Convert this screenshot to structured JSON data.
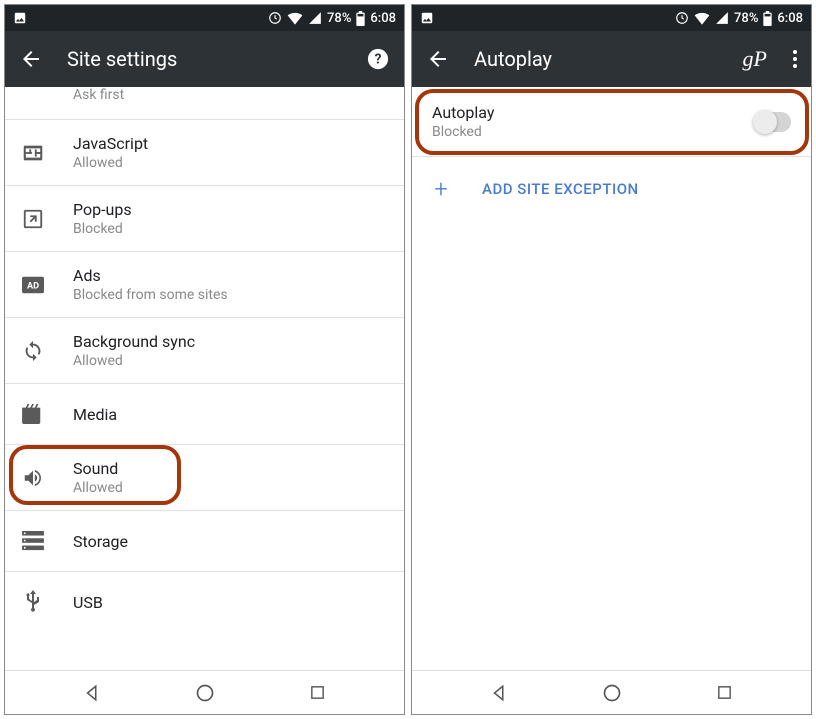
{
  "status": {
    "battery": "78%",
    "time": "6:08"
  },
  "left": {
    "title": "Site settings",
    "items": {
      "ask_first": {
        "label": "Ask first"
      },
      "javascript": {
        "label": "JavaScript",
        "sub": "Allowed"
      },
      "popups": {
        "label": "Pop-ups",
        "sub": "Blocked"
      },
      "ads": {
        "label": "Ads",
        "sub": "Blocked from some sites"
      },
      "bgsync": {
        "label": "Background sync",
        "sub": "Allowed"
      },
      "media": {
        "label": "Media"
      },
      "sound": {
        "label": "Sound",
        "sub": "Allowed"
      },
      "storage": {
        "label": "Storage"
      },
      "usb": {
        "label": "USB"
      }
    }
  },
  "right": {
    "title": "Autoplay",
    "toggle": {
      "label": "Autoplay",
      "sub": "Blocked"
    },
    "add": "ADD SITE EXCEPTION",
    "watermark": "gP"
  }
}
